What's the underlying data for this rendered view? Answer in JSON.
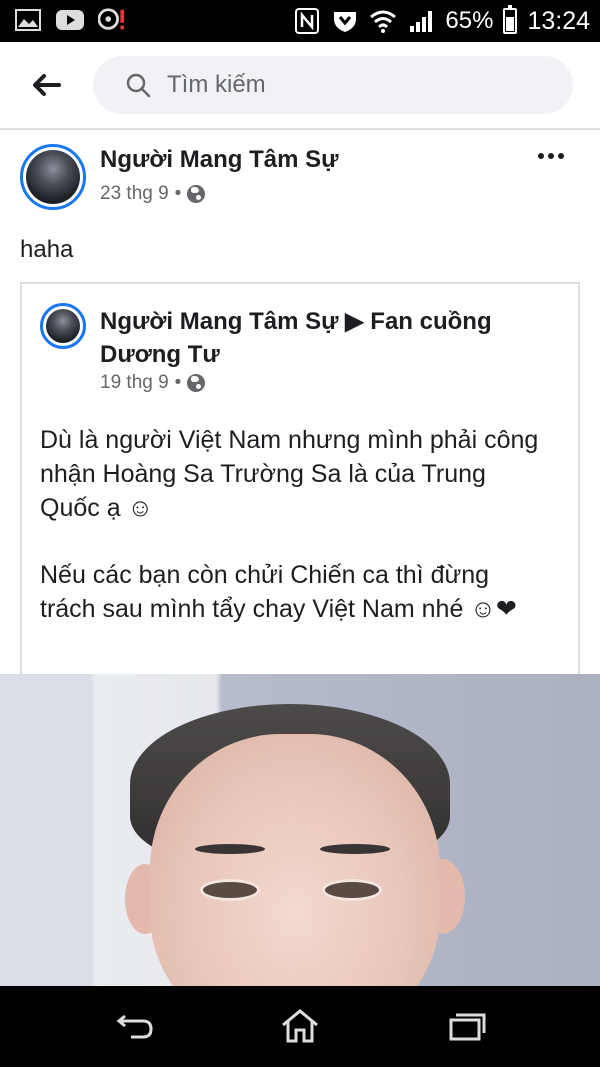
{
  "status_bar": {
    "battery": "65%",
    "battery_level": 0.65,
    "time": "13:24"
  },
  "search": {
    "placeholder": "Tìm kiếm"
  },
  "post": {
    "author": "Người Mang Tâm Sự",
    "date": "23 thg 9",
    "separator": "•",
    "text": "haha",
    "shared": {
      "author_line1": "Người Mang Tâm Sự ▶ Fan cuồng",
      "author_line2": "Dương Tư",
      "date": "19 thg 9",
      "separator": "•",
      "para1": "Dù là người Việt Nam nhưng mình phải công nhận Hoàng Sa Trường Sa là của Trung Quốc ạ ☺",
      "para2": "Nếu các bạn còn chửi Chiến ca thì đừng trách sau mình tẩy chay Việt Nam nhé ☺❤"
    }
  },
  "colors": {
    "accent": "#1877f2",
    "secondary_text": "#65676b",
    "search_bg": "#f0f2f5"
  }
}
